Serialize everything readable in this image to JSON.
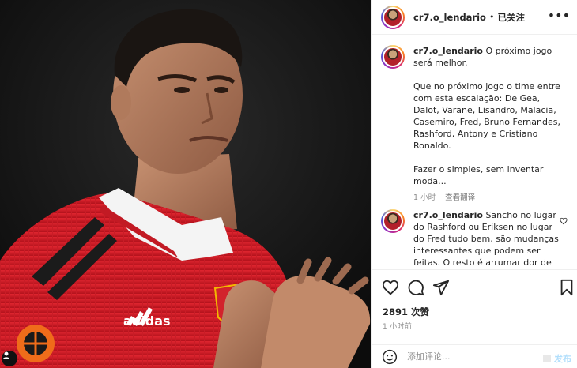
{
  "post": {
    "username": "cr7.o_lendario",
    "separator": "•",
    "follow_status": "已关注",
    "more_icon": "more-horizontal-icon"
  },
  "caption": {
    "username": "cr7.o_lendario",
    "text": "O próximo jogo será melhor.\n\nQue no próximo jogo o time entre com esta escalação: De Gea, Dalot, Varane, Lisandro, Malacia, Casemiro, Fred, Bruno Fernandes, Rashford, Antony e Cristiano Ronaldo.\n\nFazer o simples, sem inventar moda...",
    "time": "1 小时",
    "see_translation": "查看翻译"
  },
  "comments": [
    {
      "username": "cr7.o_lendario",
      "text": "Sancho no lugar do Rashford ou Eriksen no lugar do Fred tudo bem, são mudanças interessantes que podem ser feitas. O resto é arrumar dor de"
    }
  ],
  "actions": {
    "likes": "2891 次赞",
    "time": "1 小时前"
  },
  "add_comment": {
    "placeholder": "添加评论...",
    "post_label": "发布"
  },
  "media": {
    "sponsor_text": "adidas"
  },
  "colors": {
    "jersey_red": "#d8242e",
    "link_blue_disabled": "#b2dffc",
    "muted_text": "#8e8e8e"
  }
}
